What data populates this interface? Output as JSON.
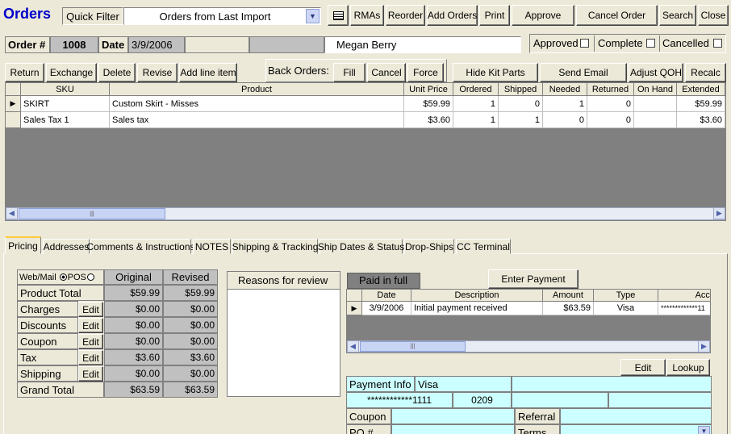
{
  "title": "Orders",
  "quick_filter": {
    "label": "Quick Filter",
    "value": "Orders from Last Import"
  },
  "toolbar": {
    "rmas": "RMAs",
    "reorder": "Reorder",
    "add_orders": "Add Orders",
    "print": "Print",
    "approve": "Approve",
    "cancel_order": "Cancel Order",
    "search": "Search",
    "close": "Close"
  },
  "order": {
    "number_label": "Order #",
    "number": "1008",
    "date_label": "Date",
    "date": "3/9/2006",
    "customer": "Megan Berry"
  },
  "status": {
    "approved": "Approved",
    "complete": "Complete",
    "cancelled": "Cancelled"
  },
  "actions": {
    "return": "Return",
    "exchange": "Exchange",
    "delete": "Delete",
    "revise": "Revise",
    "add_line_item": "Add line item",
    "back_orders": "Back Orders:",
    "fill": "Fill",
    "cancel": "Cancel",
    "force": "Force",
    "hide_kit_parts": "Hide Kit Parts",
    "send_email": "Send Email",
    "adjust_qoh": "Adjust QOH",
    "recalc": "Recalc"
  },
  "line_items": {
    "headers": [
      "SKU",
      "Product",
      "Unit Price",
      "Ordered",
      "Shipped",
      "Needed",
      "Returned",
      "On Hand",
      "Extended"
    ],
    "rows": [
      [
        "SKIRT",
        "Custom Skirt - Misses",
        "$59.99",
        "1",
        "0",
        "1",
        "0",
        "",
        "$59.99"
      ],
      [
        "Sales Tax 1",
        "Sales tax",
        "$3.60",
        "1",
        "1",
        "0",
        "0",
        "",
        "$3.60"
      ]
    ]
  },
  "tabs": [
    "Pricing",
    "Addresses",
    "Comments & Instructions",
    "NOTES",
    "Shipping & Tracking",
    "Ship Dates & Status",
    "Drop-Ships",
    "CC Terminal"
  ],
  "pricing": {
    "web_mail": "Web/Mail",
    "pos": "POS",
    "original": "Original",
    "revised": "Revised",
    "edit": "Edit",
    "rows": [
      {
        "label": "Product Total",
        "original": "$59.99",
        "revised": "$59.99",
        "editable": false
      },
      {
        "label": "Charges",
        "original": "$0.00",
        "revised": "$0.00",
        "editable": true
      },
      {
        "label": "Discounts",
        "original": "$0.00",
        "revised": "$0.00",
        "editable": true
      },
      {
        "label": "Coupon",
        "original": "$0.00",
        "revised": "$0.00",
        "editable": true
      },
      {
        "label": "Tax",
        "original": "$3.60",
        "revised": "$3.60",
        "editable": true
      },
      {
        "label": "Shipping",
        "original": "$0.00",
        "revised": "$0.00",
        "editable": true
      },
      {
        "label": "Grand Total",
        "original": "$63.59",
        "revised": "$63.59",
        "editable": false
      }
    ]
  },
  "reasons_title": "Reasons for review",
  "payments": {
    "paid_status": "Paid in full",
    "enter_payment": "Enter Payment",
    "headers": [
      "Date",
      "Description",
      "Amount",
      "Type",
      "Acct"
    ],
    "rows": [
      [
        "3/9/2006",
        "Initial payment received",
        "$63.59",
        "Visa",
        "*************11"
      ]
    ]
  },
  "payment_info": {
    "edit": "Edit",
    "lookup": "Lookup",
    "label": "Payment Info",
    "type": "Visa",
    "card_masked": "************1111",
    "expiry": "0209",
    "coupon_label": "Coupon",
    "referral_label": "Referral",
    "po_label": "PO #",
    "terms_label": "Terms"
  },
  "colors": {
    "title": "#0000cc",
    "cyan": "#ccffff",
    "grid_gray": "#808080"
  }
}
